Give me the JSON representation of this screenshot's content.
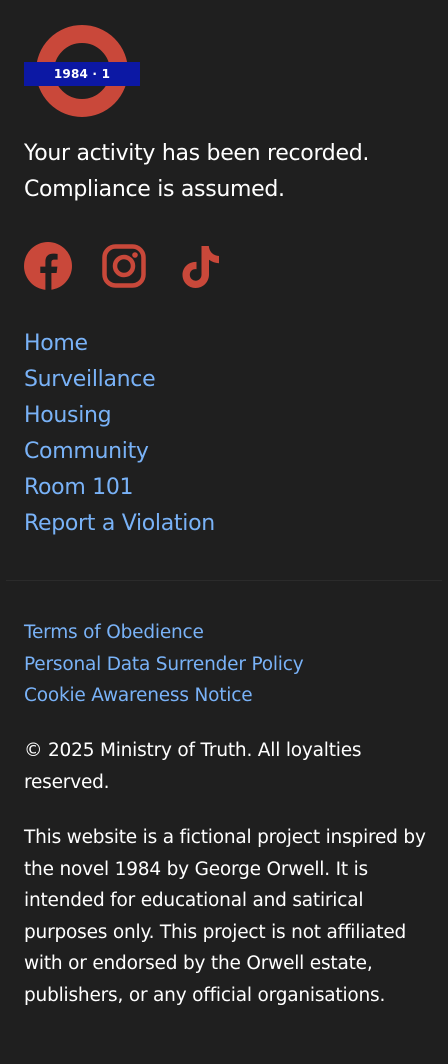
{
  "logo": {
    "text": "1984 · 1",
    "ring_color": "#c9483a",
    "bar_color": "#0c18a4",
    "icon": "roundel-logo"
  },
  "tagline": {
    "line1": "Your activity has been recorded.",
    "line2": "Compliance is assumed."
  },
  "socials": [
    {
      "icon": "facebook-icon"
    },
    {
      "icon": "instagram-icon"
    },
    {
      "icon": "tiktok-icon"
    }
  ],
  "social_color": "#c9483a",
  "nav": {
    "items": [
      {
        "label": "Home"
      },
      {
        "label": "Surveillance"
      },
      {
        "label": "Housing"
      },
      {
        "label": "Community"
      },
      {
        "label": "Room 101"
      },
      {
        "label": "Report a Violation"
      }
    ]
  },
  "link_color": "#79b2f7",
  "legal": {
    "items": [
      {
        "label": "Terms of Obedience"
      },
      {
        "label": "Personal Data Surrender Policy"
      },
      {
        "label": "Cookie Awareness Notice"
      }
    ]
  },
  "footer": {
    "copyright": "© 2025 Ministry of Truth. All loyalties reserved.",
    "disclaimer": "This website is a fictional project inspired by the novel 1984 by George Orwell. It is intended for educational and satirical purposes only. This project is not affiliated with or endorsed by the Orwell estate, publishers, or any official organisations."
  }
}
